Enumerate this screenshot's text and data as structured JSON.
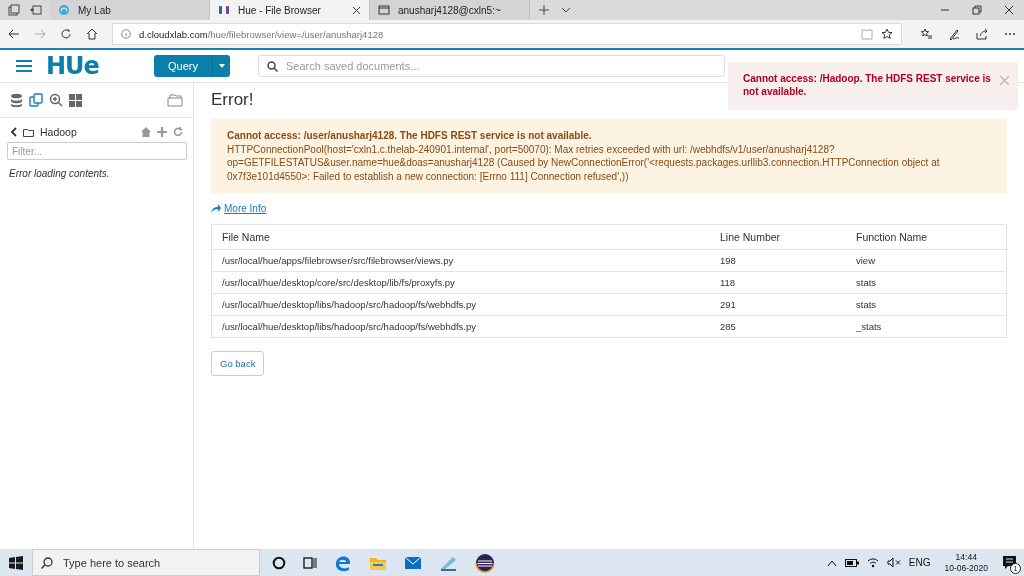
{
  "browser": {
    "tabs": [
      {
        "label": "My Lab",
        "selected": false
      },
      {
        "label": "Hue - File Browser",
        "selected": true
      },
      {
        "label": "anusharj4128@cxln5:~",
        "selected": false
      }
    ],
    "address": {
      "domain": "d.cloudxlab.com",
      "path": "/hue/filebrowser/view=/user/anusharj4128"
    }
  },
  "header": {
    "logo": "HUe",
    "query_button": "Query",
    "search": {
      "placeholder": "Search saved documents..."
    }
  },
  "notification": {
    "message": "Cannot access: /Hadoop. The HDFS REST service is not available."
  },
  "sidebar": {
    "path": "Hadoop",
    "filter": {
      "placeholder": "Filter..."
    },
    "message": "Error loading contents."
  },
  "error": {
    "title": "Error!",
    "headline": "Cannot access: /user/anusharj4128. The HDFS REST service is not available.",
    "detail": "HTTPConnectionPool(host='cxln1.c.thelab-240901.internal', port=50070): Max retries exceeded with url: /webhdfs/v1/user/anusharj4128?op=GETFILESTATUS&user.name=hue&doas=anusharj4128 (Caused by NewConnectionError('<requests.packages.urllib3.connection.HTTPConnection object at 0x7f3e101d4550>: Failed to establish a new connection: [Errno 111] Connection refused',))",
    "more_info": "More Info",
    "table": {
      "columns": [
        "File Name",
        "Line Number",
        "Function Name"
      ],
      "rows": [
        [
          "/usr/local/hue/apps/filebrowser/src/filebrowser/views.py",
          "198",
          "view"
        ],
        [
          "/usr/local/hue/desktop/core/src/desktop/lib/fs/proxyfs.py",
          "118",
          "stats"
        ],
        [
          "/usr/local/hue/desktop/libs/hadoop/src/hadoop/fs/webhdfs.py",
          "291",
          "stats"
        ],
        [
          "/usr/local/hue/desktop/libs/hadoop/src/hadoop/fs/webhdfs.py",
          "285",
          "_stats"
        ]
      ]
    },
    "go_back": "Go back"
  },
  "taskbar": {
    "search": {
      "placeholder": "Type here to search"
    },
    "language": "ENG",
    "time": "14:44",
    "date": "10-06-2020",
    "notification_count": "1"
  }
}
